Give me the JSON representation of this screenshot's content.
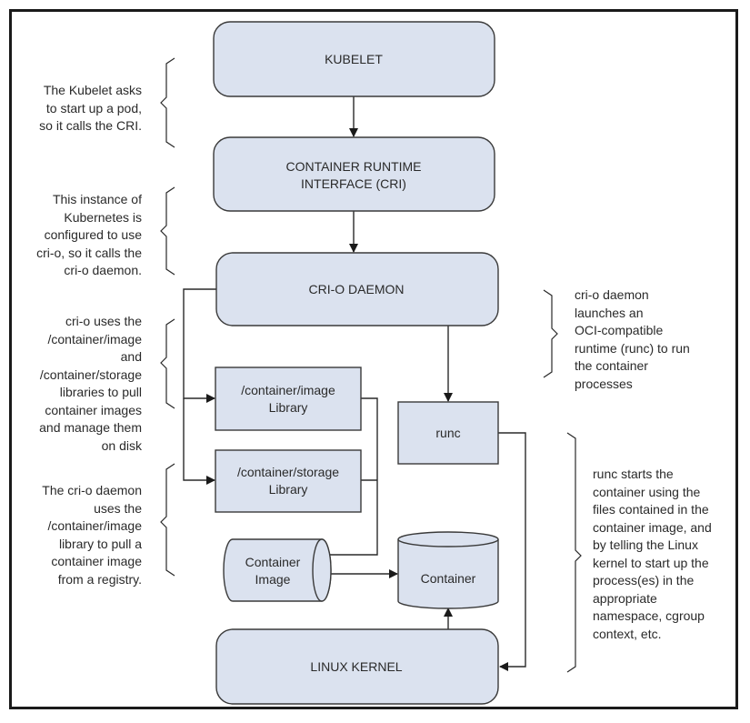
{
  "diagram": {
    "colors": {
      "box_fill": "#dbe2ef",
      "box_stroke": "#3a3a3a",
      "line": "#2a2a2a",
      "frame": "#1a1a1a"
    },
    "nodes": {
      "kubelet": {
        "label": "KUBELET"
      },
      "cri": {
        "line1": "CONTAINER RUNTIME",
        "line2": "INTERFACE (CRI)"
      },
      "crio": {
        "label": "CRI-O DAEMON"
      },
      "image_lib": {
        "line1": "/container/image",
        "line2": "Library"
      },
      "storage_lib": {
        "line1": "/container/storage",
        "line2": "Library"
      },
      "runc": {
        "label": "runc"
      },
      "container_image": {
        "line1": "Container",
        "line2": "Image"
      },
      "container": {
        "label": "Container"
      },
      "kernel": {
        "label": "LINUX KERNEL"
      }
    },
    "edges": [
      {
        "from": "kubelet",
        "to": "cri"
      },
      {
        "from": "cri",
        "to": "crio"
      },
      {
        "from": "crio",
        "to": "image_lib"
      },
      {
        "from": "crio",
        "to": "storage_lib"
      },
      {
        "from": "crio",
        "to": "runc"
      },
      {
        "from": "image_lib",
        "to": "container_image"
      },
      {
        "from": "storage_lib",
        "to": "container_image"
      },
      {
        "from": "container_image",
        "to": "container"
      },
      {
        "from": "runc",
        "to": "kernel"
      },
      {
        "from": "kernel",
        "to": "container"
      }
    ],
    "annotations": {
      "kubelet_note": [
        "The Kubelet asks",
        "to start up a pod,",
        "so it calls the CRI."
      ],
      "cri_note": [
        "This instance of",
        "Kubernetes is",
        "configured to use",
        "cri-o, so it calls the",
        "cri-o daemon."
      ],
      "libraries_note": [
        "cri-o uses the",
        "/container/image",
        "and",
        "/container/storage",
        "libraries to pull",
        "container images",
        "and manage them",
        "on disk"
      ],
      "pull_note": [
        "The cri-o daemon",
        "uses the",
        "/container/image",
        "library to pull a",
        "container image",
        "from a registry."
      ],
      "crio_note": [
        "cri-o daemon",
        "launches an",
        "OCI-compatible",
        "runtime (runc) to run",
        "the container",
        "processes"
      ],
      "runc_note": [
        "runc starts the",
        "container using the",
        "files contained in the",
        "container image, and",
        "by telling the Linux",
        "kernel to start up the",
        "process(es) in the",
        "appropriate",
        "namespace, cgroup",
        "context, etc."
      ]
    }
  }
}
